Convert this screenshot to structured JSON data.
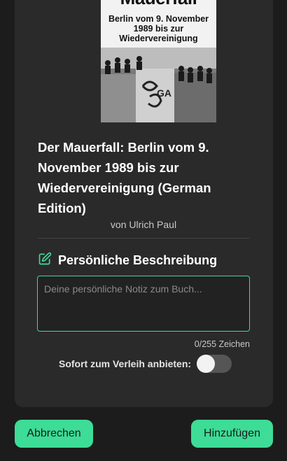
{
  "book": {
    "cover": {
      "title": "Mauerfall",
      "subtitle": "Berlin vom 9. November 1989 bis zur Wiedervereinigung"
    },
    "title": "Der Mauerfall: Berlin vom 9. November 1989 bis zur Wiedervereinigung (German Edition)",
    "author": "von Ulrich Paul"
  },
  "description": {
    "heading": "Persönliche Beschreibung",
    "icon": "edit-icon",
    "placeholder": "Deine persönliche Notiz zum Buch...",
    "value": "",
    "counter": "0/255 Zeichen"
  },
  "lending": {
    "label": "Sofort zum Verleih anbieten:",
    "enabled": false
  },
  "actions": {
    "cancel_label": "Abbrechen",
    "add_label": "Hinzufügen"
  },
  "colors": {
    "accent": "#3ddc97",
    "background": "#1c1c1c",
    "card": "#2a2a2a"
  }
}
